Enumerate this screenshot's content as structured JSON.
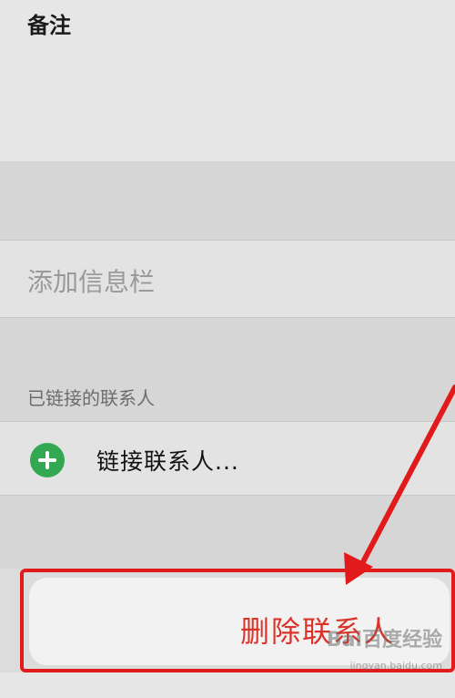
{
  "notes": {
    "label": "备注"
  },
  "add_field": {
    "label": "添加信息栏"
  },
  "linked_contacts": {
    "section_header": "已链接的联系人",
    "link_label": "链接联系人...",
    "link_icon": "plus-circle-icon",
    "link_icon_color": "#33a852"
  },
  "delete": {
    "label": "删除联系人",
    "text_color": "#d9332a"
  },
  "annotation": {
    "color": "#e11b1b"
  },
  "watermark": {
    "logo": "Bai百度经验",
    "url": "jingyan.baidu.com"
  }
}
